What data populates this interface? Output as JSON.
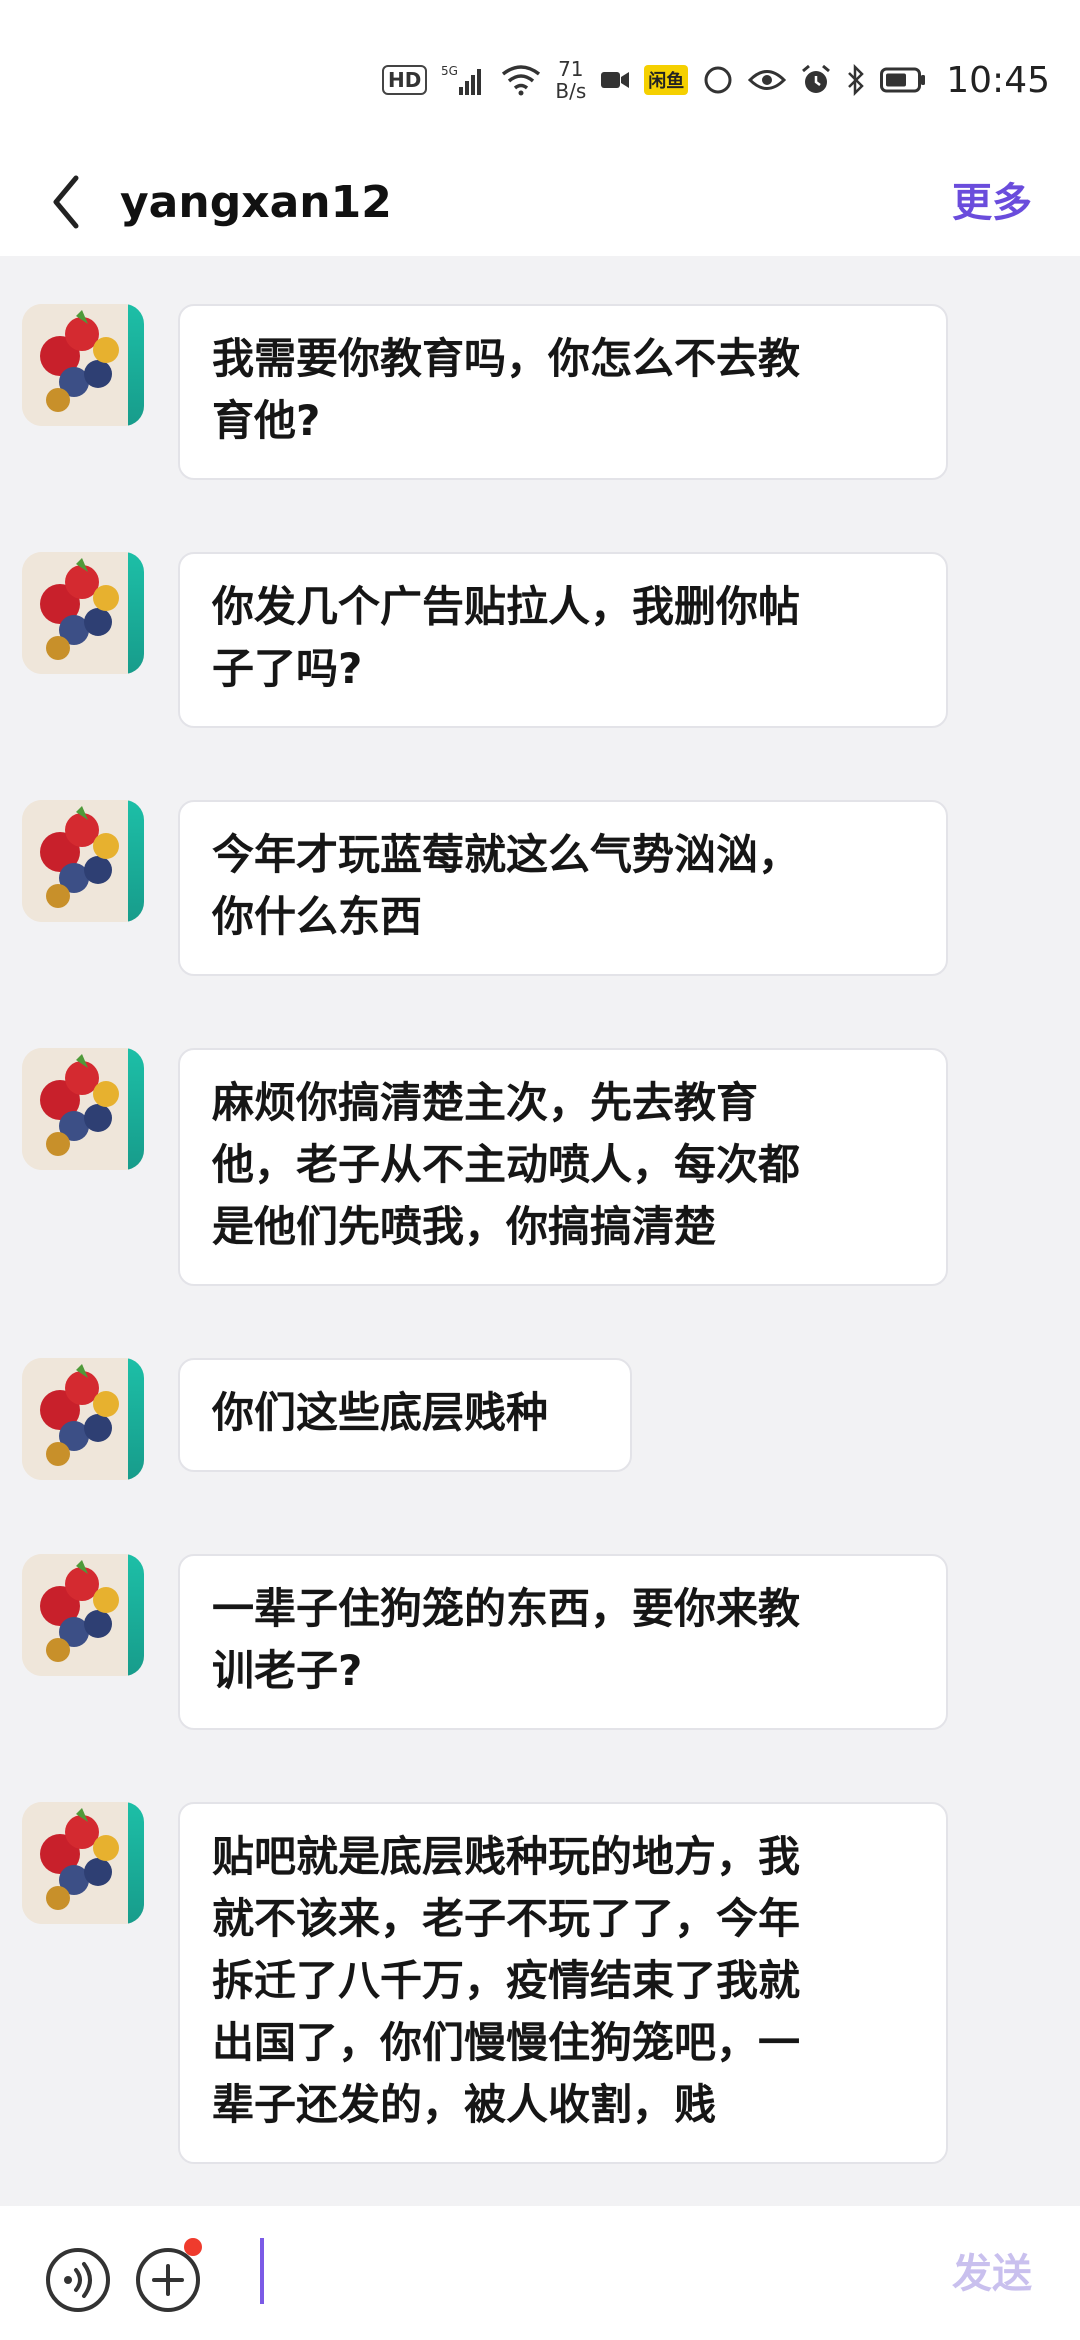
{
  "status_bar": {
    "hd": "HD",
    "net_speed_value": "71",
    "net_speed_unit": "B/s",
    "badge": "闲鱼",
    "time": "10:45"
  },
  "header": {
    "title": "yangxan12",
    "more_label": "更多"
  },
  "messages": [
    {
      "text": "我需要你教育吗，你怎么不去教\n育他?"
    },
    {
      "text": "你发几个广告贴拉人，我删你帖\n子了吗?"
    },
    {
      "text": "今年才玩蓝莓就这么气势汹汹，\n你什么东西"
    },
    {
      "text": "麻烦你搞清楚主次，先去教育\n他，老子从不主动喷人，每次都\n是他们先喷我，你搞搞清楚"
    },
    {
      "text": "你们这些底层贱种"
    },
    {
      "text": "一辈子住狗笼的东西，要你来教\n训老子?"
    },
    {
      "text": "贴吧就是底层贱种玩的地方，我\n就不该来，老子不玩了了，今年\n拆迁了八千万，疫情结束了我就\n出国了，你们慢慢住狗笼吧，一\n辈子还发的，被人收割，贱"
    }
  ],
  "input_bar": {
    "placeholder": "",
    "send_label": "发送"
  },
  "colors": {
    "accent": "#6a4cdc",
    "send_disabled": "#c9c0ee",
    "chat_bg": "#f2f2f4",
    "bubble_bg": "#ffffff"
  }
}
